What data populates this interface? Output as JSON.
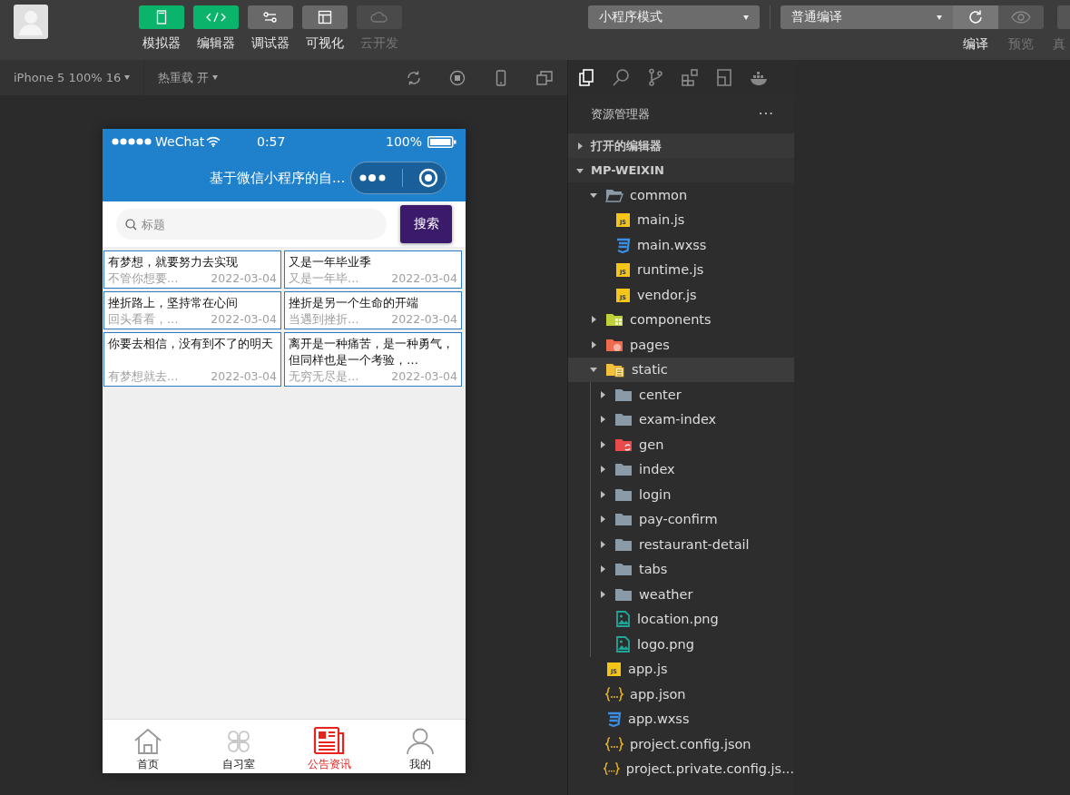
{
  "toolbar": {
    "tools": [
      {
        "label": "模拟器",
        "kind": "phone",
        "selected": true,
        "disabled": false
      },
      {
        "label": "编辑器",
        "kind": "code",
        "selected": true,
        "disabled": false
      },
      {
        "label": "调试器",
        "kind": "sliders",
        "selected": false,
        "disabled": false
      },
      {
        "label": "可视化",
        "kind": "layout",
        "selected": false,
        "disabled": false
      },
      {
        "label": "云开发",
        "kind": "cloud",
        "selected": false,
        "disabled": true
      }
    ],
    "mode_select": {
      "value": "小程序模式"
    },
    "compile_select": {
      "value": "普通编译"
    },
    "actions": [
      {
        "label": "编译",
        "kind": "refresh",
        "disabled": false
      },
      {
        "label": "预览",
        "kind": "eye",
        "disabled": true
      },
      {
        "label": "真",
        "kind": "blank",
        "disabled": true
      }
    ]
  },
  "simulator_toolbar": {
    "device": "iPhone 5 100% 16",
    "hot_reload": "热重载 开"
  },
  "phone": {
    "status_bar": {
      "carrier": "WeChat",
      "time": "0:57",
      "battery": "100%"
    },
    "nav_title": "基于微信小程序的自...",
    "search": {
      "placeholder": "标题",
      "button": "搜索"
    },
    "articles": [
      {
        "title": "有梦想，就要努力去实现",
        "summary": "不管你想要…",
        "date": "2022-03-04"
      },
      {
        "title": "又是一年毕业季",
        "summary": "又是一年毕…",
        "date": "2022-03-04"
      },
      {
        "title": "挫折路上，坚持常在心间",
        "summary": "回头看看，…",
        "date": "2022-03-04"
      },
      {
        "title": "挫折是另一个生命的开端",
        "summary": "当遇到挫折…",
        "date": "2022-03-04"
      },
      {
        "title": "你要去相信，没有到不了的明天",
        "summary": "有梦想就去…",
        "date": "2022-03-04"
      },
      {
        "title": "离开是一种痛苦，是一种勇气，但同样也是一个考验，…",
        "summary": "无穷无尽是…",
        "date": "2022-03-04"
      }
    ],
    "tabs": [
      {
        "label": "首页",
        "kind": "home",
        "selected": false
      },
      {
        "label": "自习室",
        "kind": "clover",
        "selected": false
      },
      {
        "label": "公告资讯",
        "kind": "news",
        "selected": true
      },
      {
        "label": "我的",
        "kind": "person",
        "selected": false
      }
    ]
  },
  "explorer": {
    "activity": [
      {
        "kind": "files",
        "selected": true
      },
      {
        "kind": "search",
        "selected": false
      },
      {
        "kind": "branch",
        "selected": false
      },
      {
        "kind": "blocks",
        "selected": false
      },
      {
        "kind": "disk",
        "selected": false
      },
      {
        "kind": "whale",
        "selected": false
      }
    ],
    "title": "资源管理器",
    "more": "···",
    "sections": [
      {
        "label": "打开的编辑器",
        "expanded": false
      },
      {
        "label": "MP-WEIXIN",
        "expanded": true,
        "tree": [
          {
            "name": "common",
            "kind": "folder",
            "expanded": true,
            "selected": false,
            "children": [
              {
                "name": "main.js",
                "kind": "js",
                "badge": "JS",
                "selected": false
              },
              {
                "name": "main.wxss",
                "kind": "css",
                "selected": false
              },
              {
                "name": "runtime.js",
                "kind": "js",
                "badge": "JS",
                "selected": false
              },
              {
                "name": "vendor.js",
                "kind": "js",
                "badge": "JS",
                "selected": false
              }
            ]
          },
          {
            "name": "components",
            "kind": "folder-components",
            "expanded": false,
            "selected": false
          },
          {
            "name": "pages",
            "kind": "folder-pages",
            "expanded": false,
            "selected": false
          },
          {
            "name": "static",
            "kind": "folder-static",
            "expanded": true,
            "selected": true,
            "children": [
              {
                "name": "center",
                "kind": "folder-plain",
                "expanded": false,
                "selected": false
              },
              {
                "name": "exam-index",
                "kind": "folder-plain",
                "expanded": false,
                "selected": false
              },
              {
                "name": "gen",
                "kind": "folder-gen",
                "expanded": false,
                "selected": false
              },
              {
                "name": "index",
                "kind": "folder-plain",
                "expanded": false,
                "selected": false
              },
              {
                "name": "login",
                "kind": "folder-plain",
                "expanded": false,
                "selected": false
              },
              {
                "name": "pay-confirm",
                "kind": "folder-plain",
                "expanded": false,
                "selected": false
              },
              {
                "name": "restaurant-detail",
                "kind": "folder-plain",
                "expanded": false,
                "selected": false
              },
              {
                "name": "tabs",
                "kind": "folder-plain",
                "expanded": false,
                "selected": false
              },
              {
                "name": "weather",
                "kind": "folder-plain",
                "expanded": false,
                "selected": false
              },
              {
                "name": "location.png",
                "kind": "image",
                "selected": false
              },
              {
                "name": "logo.png",
                "kind": "image",
                "selected": false
              }
            ]
          },
          {
            "name": "app.js",
            "kind": "js",
            "badge": "JS",
            "selected": false
          },
          {
            "name": "app.json",
            "kind": "json",
            "selected": false
          },
          {
            "name": "app.wxss",
            "kind": "css",
            "selected": false
          },
          {
            "name": "project.config.json",
            "kind": "json",
            "selected": false
          },
          {
            "name": "project.private.config.js...",
            "kind": "json",
            "selected": false
          }
        ]
      }
    ]
  }
}
